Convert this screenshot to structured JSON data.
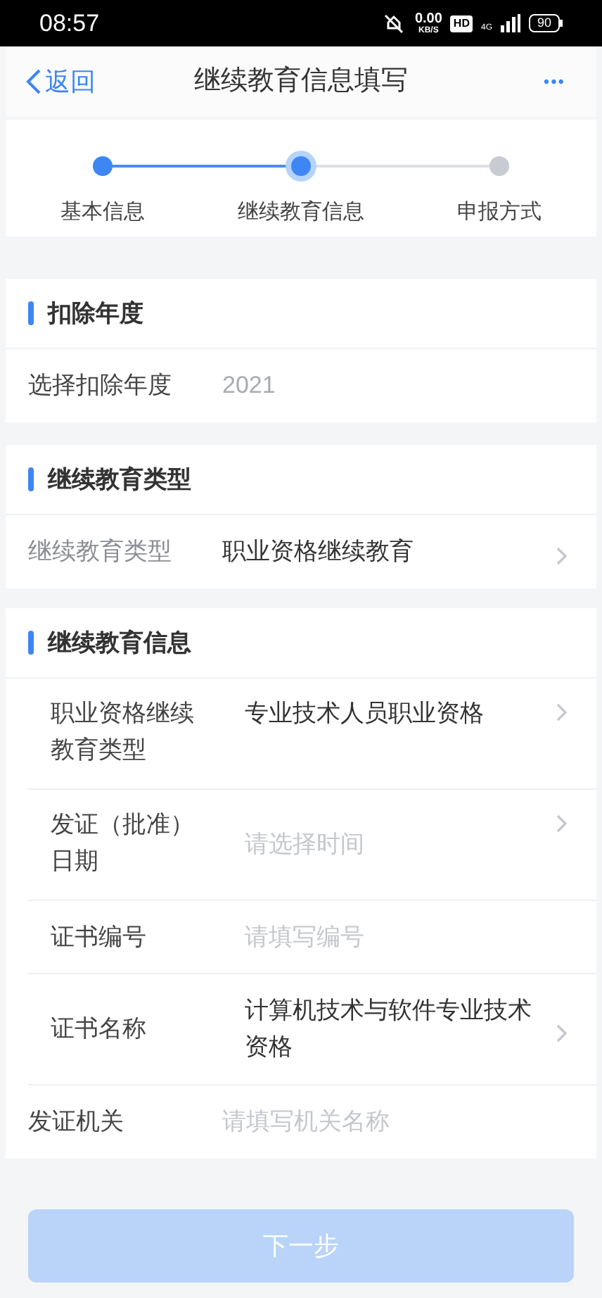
{
  "status_bar": {
    "time": "08:57",
    "net_speed": "0.00",
    "net_unit": "KB/S",
    "hd": "HD",
    "network": "4G",
    "battery": "90"
  },
  "header": {
    "back": "返回",
    "title": "继续教育信息填写",
    "more": "•••"
  },
  "steps": [
    {
      "label": "基本信息",
      "completed": true,
      "selected": false
    },
    {
      "label": "继续教育信息",
      "completed": true,
      "selected": true
    },
    {
      "label": "申报方式",
      "completed": false,
      "selected": false
    }
  ],
  "sections": [
    {
      "title": "扣除年度",
      "rows": [
        {
          "label": "选择扣除年度",
          "value": "2021",
          "disabled": true,
          "label_dimmed": false,
          "chevron": false
        }
      ]
    },
    {
      "title": "继续教育类型",
      "rows": [
        {
          "label": "继续教育类型",
          "value": "职业资格继续教育",
          "disabled": false,
          "label_dimmed": true,
          "chevron": true
        }
      ]
    },
    {
      "title": "继续教育信息",
      "rows": [
        {
          "label": "职业资格继续教育类型",
          "value": "专业技术人员职业资格",
          "disabled": false,
          "label_dimmed": false,
          "chevron": true
        },
        {
          "label": "发证（批准）日期",
          "placeholder": "请选择时间",
          "disabled": false,
          "label_dimmed": false,
          "chevron": true
        },
        {
          "label": "证书编号",
          "placeholder": "请填写编号",
          "disabled": false,
          "label_dimmed": false,
          "chevron": false
        },
        {
          "label": "证书名称",
          "value": "计算机技术与软件专业技术资格",
          "disabled": false,
          "label_dimmed": false,
          "chevron": true
        },
        {
          "label": "发证机关",
          "placeholder": "请填写机关名称",
          "disabled": false,
          "label_dimmed": false,
          "chevron": false
        }
      ]
    }
  ],
  "next_button": {
    "label": "下一步",
    "disabled": true
  }
}
